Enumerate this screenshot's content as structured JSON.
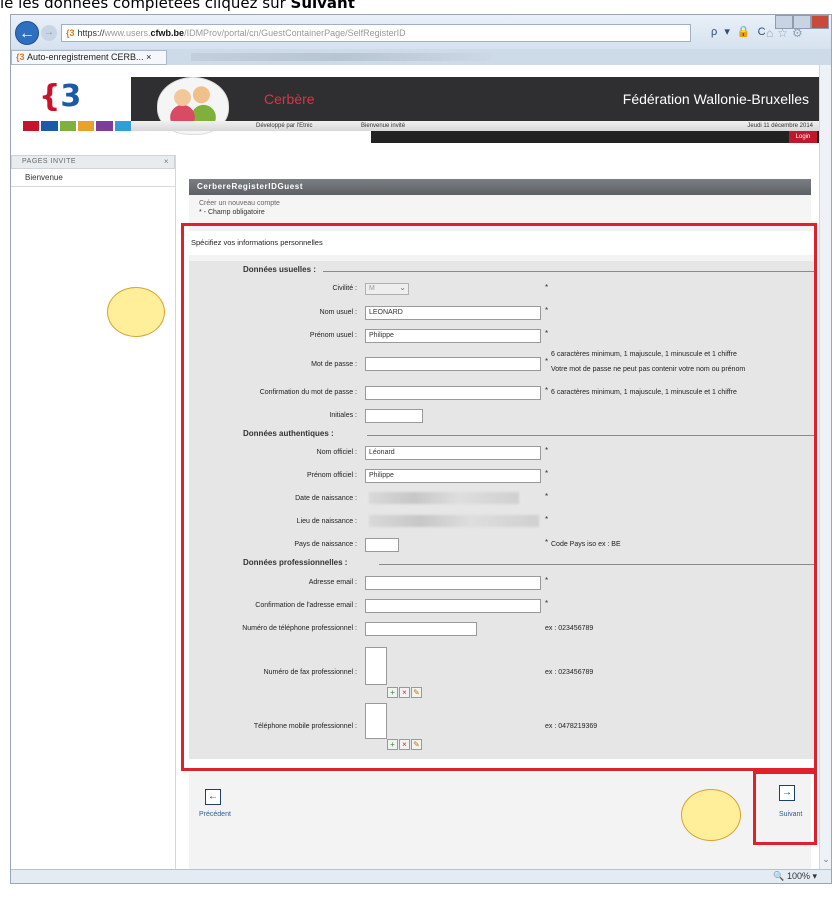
{
  "caption": {
    "text_start": "ie les données complétées cliquez sur ",
    "text_bold": "Suivant"
  },
  "browser": {
    "back_icon": "back-arrow-icon",
    "url_prefix": "https://",
    "url_blur_part": "www.users.",
    "url_domain": "cfwb.be",
    "url_path": "/IDMProv/portal/cn/GuestContainerPage/SelfRegisterID",
    "url_tools": "ρ ▾ 🔒 C",
    "tab_title": "Auto-enregistrement CERB...",
    "tab_close": "×",
    "zoom": "100%"
  },
  "header": {
    "site_name": "Cerbère",
    "org": "Fédération Wallonie-Bruxelles",
    "dev_by": "Développé par l'Etnic",
    "welcome": "Bienvenue invité",
    "date": "Jeudi 11 décembre 2014",
    "login": "Login",
    "brand_colors": [
      "#c9132c",
      "#1b5aa6",
      "#7fb03b",
      "#e8a12a",
      "#7c3f98",
      "#2f9fd7"
    ]
  },
  "sidebar": {
    "heading": "PAGES INVITE",
    "close": "×",
    "items": [
      {
        "label": "Bienvenue"
      }
    ]
  },
  "portlet": {
    "title": "CerbereRegisterIDGuest",
    "intro_line1": "Créer un nouveau compte",
    "intro_line2": "* - Champ obligatoire"
  },
  "form": {
    "specify": "Spécifiez vos informations personnelles",
    "section_usual": "Données usuelles :",
    "section_authentic": "Données authentiques :",
    "section_professional": "Données professionnelles :",
    "civilite_label": "Civilité :",
    "civilite_value": "M",
    "nom_usuel_label": "Nom usuel :",
    "nom_usuel_value": "LEONARD",
    "prenom_usuel_label": "Prénom usuel :",
    "prenom_usuel_value": "Philippe",
    "mdp_label": "Mot de passe :",
    "mdp_hint1": "6 caractères minimum, 1 majuscule, 1 minuscule et 1 chiffre",
    "mdp_hint2": "Votre mot de passe ne peut pas contenir votre nom ou prénom",
    "confirm_mdp_label": "Confirmation du mot de passe :",
    "confirm_mdp_hint": "6 caractères minimum, 1 majuscule, 1 minuscule et 1 chiffre",
    "initiales_label": "Initiales :",
    "nom_officiel_label": "Nom officiel :",
    "nom_officiel_value": "Léonard",
    "prenom_officiel_label": "Prénom officiel :",
    "prenom_officiel_value": "Philippe",
    "date_naissance_label": "Date de naissance :",
    "lieu_naissance_label": "Lieu de naissance :",
    "pays_naissance_label": "Pays de naissance :",
    "pays_hint": "Code Pays iso ex : BE",
    "email_label": "Adresse email :",
    "confirm_email_label": "Confirmation de l'adresse email :",
    "tel_label": "Numéro de téléphone professionnel :",
    "tel_hint": "ex : 023456789",
    "fax_label": "Numéro de fax professionnel :",
    "fax_hint": "ex : 023456789",
    "mobile_label": "Téléphone mobile professionnel :",
    "mobile_hint": "ex : 0478219369",
    "star": "*"
  },
  "nav": {
    "prev_label": "Précédent",
    "next_label": "Suivant",
    "prev_icon": "←",
    "next_icon": "→"
  },
  "annotation": {
    "highlight_color": "#e0212b",
    "marker_color": "#ffef9a"
  }
}
